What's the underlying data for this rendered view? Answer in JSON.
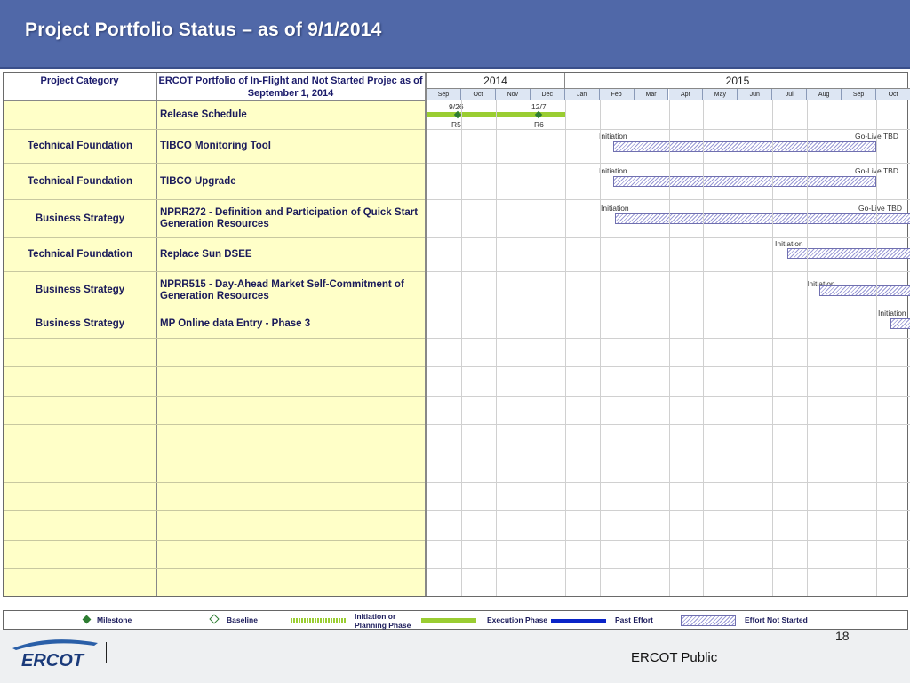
{
  "header": {
    "title": "Project Portfolio Status – as of 9/1/2014"
  },
  "table": {
    "col_category": "Project Category",
    "col_project": "ERCOT Portfolio of In-Flight and Not Started Projec as of September 1, 2014"
  },
  "timeline": {
    "years": [
      {
        "label": "2014",
        "months": 4
      },
      {
        "label": "2015",
        "months": 10
      }
    ],
    "months": [
      "Sep",
      "Oct",
      "Nov",
      "Dec",
      "Jan",
      "Feb",
      "Mar",
      "Apr",
      "May",
      "Jun",
      "Jul",
      "Aug",
      "Sep",
      "Oct"
    ]
  },
  "rows": [
    {
      "category": "",
      "project": "Release Schedule"
    },
    {
      "category": "Technical Foundation",
      "project": "TIBCO Monitoring Tool",
      "phase_label": "Initiation",
      "end_label": "Go-Live TBD"
    },
    {
      "category": "Technical Foundation",
      "project": "TIBCO Upgrade",
      "phase_label": "Initiation",
      "end_label": "Go-Live TBD"
    },
    {
      "category": "Business Strategy",
      "project": "NPRR272 - Definition and Participation of Quick Start Generation Resources",
      "phase_label": "Initiation",
      "end_label": "Go-Live TBD"
    },
    {
      "category": "Technical Foundation",
      "project": "Replace Sun DSEE",
      "phase_label": "Initiation"
    },
    {
      "category": "Business Strategy",
      "project": "NPRR515 - Day-Ahead Market Self-Commitment of Generation Resources",
      "phase_label": "Initiation"
    },
    {
      "category": "Business Strategy",
      "project": "MP Online data Entry - Phase 3",
      "phase_label": "Initiation"
    }
  ],
  "release": {
    "milestones": [
      {
        "date": "9/26",
        "name": "R5"
      },
      {
        "date": "12/7",
        "name": "R6"
      }
    ]
  },
  "legend": {
    "milestone": "Milestone",
    "baseline": "Baseline",
    "initiation": "Initiation or Planning Phase",
    "execution": "Execution Phase",
    "past": "Past Effort",
    "not_started": "Effort Not Started"
  },
  "footer": {
    "page": "18",
    "public": "ERCOT Public",
    "logo": "ERCOT"
  },
  "colors": {
    "header": "#5068a8",
    "left_panel": "#ffffc8",
    "execution": "#9acd32",
    "past": "#0a24c8",
    "milestone": "#2e7d32"
  }
}
